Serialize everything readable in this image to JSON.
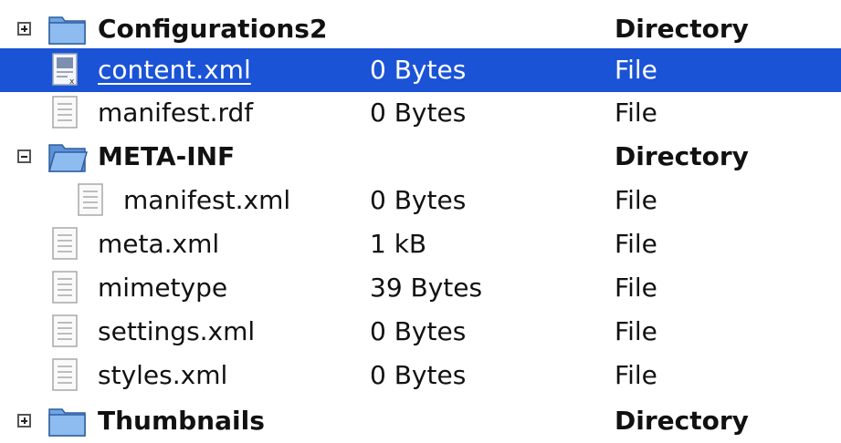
{
  "tree": {
    "rows": [
      {
        "name": "Configurations2",
        "size": "",
        "kind": "Directory",
        "icon": "folder-icon",
        "toggle": "expand",
        "selected": false
      },
      {
        "name": "content.xml",
        "size": "0 Bytes",
        "kind": "File",
        "icon": "xml-file-icon",
        "toggle": "",
        "selected": true
      },
      {
        "name": "manifest.rdf",
        "size": "0 Bytes",
        "kind": "File",
        "icon": "file-icon",
        "toggle": "",
        "selected": false
      },
      {
        "name": "META-INF",
        "size": "",
        "kind": "Directory",
        "icon": "folder-open-icon",
        "toggle": "collapse",
        "selected": false
      },
      {
        "name": "manifest.xml",
        "size": "0 Bytes",
        "kind": "File",
        "icon": "file-icon",
        "toggle": "",
        "selected": false
      },
      {
        "name": "meta.xml",
        "size": "1 kB",
        "kind": "File",
        "icon": "file-icon",
        "toggle": "",
        "selected": false
      },
      {
        "name": "mimetype",
        "size": "39 Bytes",
        "kind": "File",
        "icon": "file-icon",
        "toggle": "",
        "selected": false
      },
      {
        "name": "settings.xml",
        "size": "0 Bytes",
        "kind": "File",
        "icon": "file-icon",
        "toggle": "",
        "selected": false
      },
      {
        "name": "styles.xml",
        "size": "0 Bytes",
        "kind": "File",
        "icon": "file-icon",
        "toggle": "",
        "selected": false
      },
      {
        "name": "Thumbnails",
        "size": "",
        "kind": "Directory",
        "icon": "folder-icon",
        "toggle": "expand",
        "selected": false
      }
    ]
  },
  "colors": {
    "selection": "#1a53d6",
    "folder": "#6fa5e6"
  }
}
